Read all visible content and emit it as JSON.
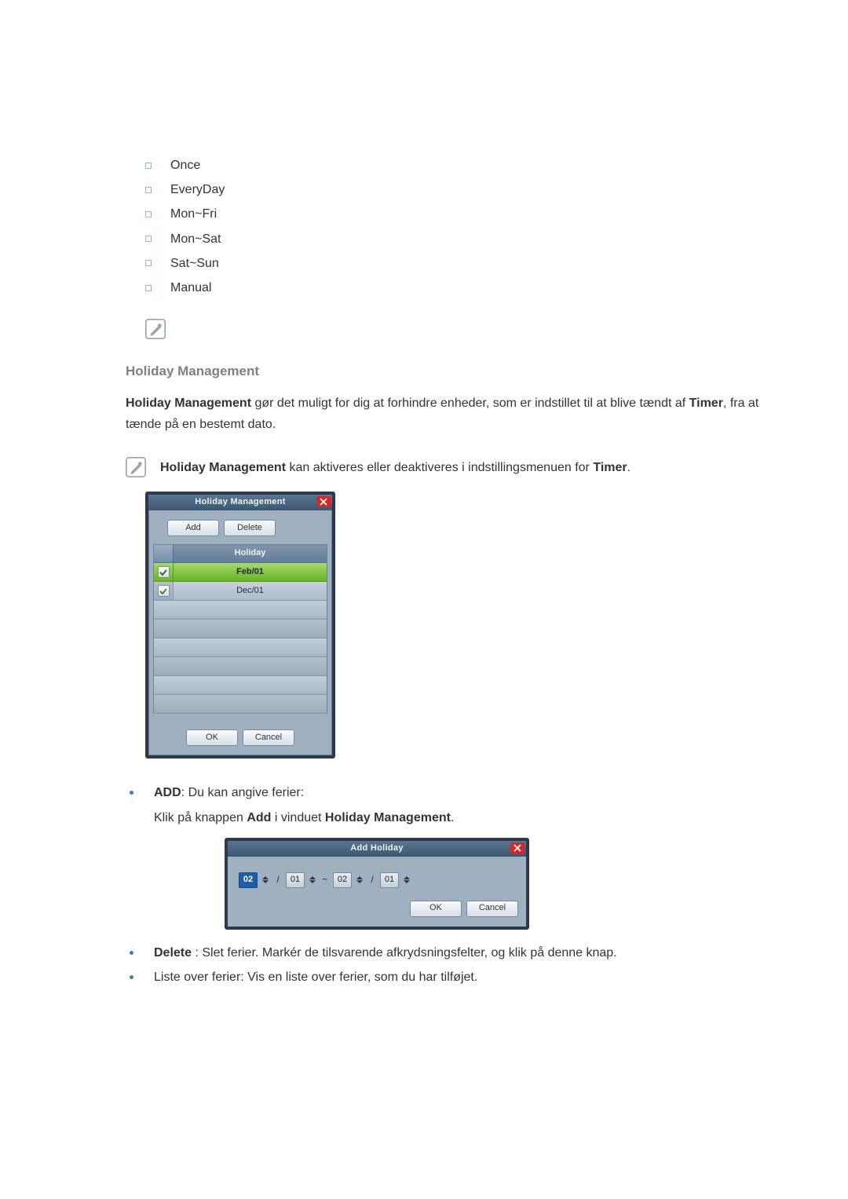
{
  "options": [
    "Once",
    "EveryDay",
    "Mon~Fri",
    "Mon~Sat",
    "Sat~Sun",
    "Manual"
  ],
  "hm_heading": "Holiday Management",
  "para1": {
    "a": "Holiday Management",
    "b": " gør det muligt for dig at forhindre enheder, som er indstillet til at blive tændt af ",
    "c": "Timer",
    "d": ", fra at tænde på en bestemt dato."
  },
  "note": {
    "a": "Holiday Management",
    "b": " kan aktiveres eller deaktiveres i indstillingsmenuen for ",
    "c": "Timer",
    "d": "."
  },
  "dlg": {
    "title": "Holiday Management",
    "add": "Add",
    "delete": "Delete",
    "col_chk_hdr": "",
    "col_label": "Holiday",
    "rows": [
      {
        "value": "Feb/01",
        "checked": true,
        "selected": true
      },
      {
        "value": "Dec/01",
        "checked": true,
        "selected": false
      }
    ],
    "blank_rows": 6,
    "ok": "OK",
    "cancel": "Cancel"
  },
  "desc": {
    "add_label": "ADD",
    "add_text": ": Du kan angive ferier:",
    "add_sub_a": "Klik på knappen ",
    "add_sub_b": "Add",
    "add_sub_c": " i vinduet ",
    "add_sub_d": "Holiday Management",
    "add_sub_e": ".",
    "delete_label": "Delete",
    "delete_text": " : Slet ferier. Markér de tilsvarende afkrydsningsfelter, og klik på denne knap.",
    "list_text": "Liste over ferier: Vis en liste over ferier, som du har tilføjet."
  },
  "dlg2": {
    "title": "Add Holiday",
    "from_m": "02",
    "from_d": "01",
    "to_m": "02",
    "to_d": "01",
    "slash": "/",
    "tilde": "~",
    "ok": "OK",
    "cancel": "Cancel"
  }
}
